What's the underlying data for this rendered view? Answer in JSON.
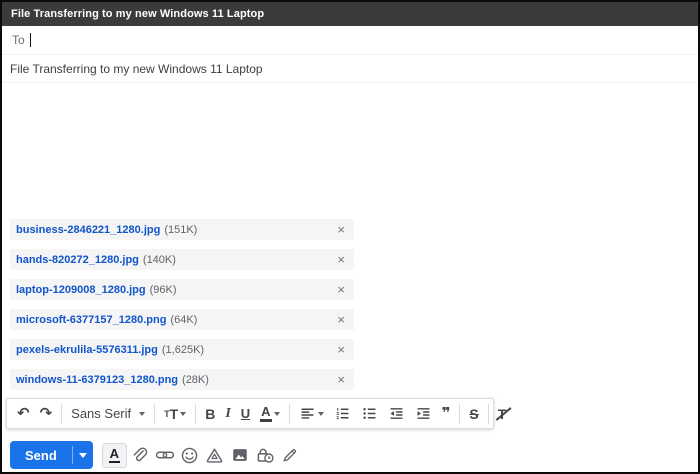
{
  "window": {
    "title": "File Transferring to my new Windows 11 Laptop"
  },
  "compose": {
    "to_label": "To",
    "subject": "File Transferring to my new Windows 11 Laptop",
    "attachments": [
      {
        "name": "business-2846221_1280.jpg",
        "size": "(151K)"
      },
      {
        "name": "hands-820272_1280.jpg",
        "size": "(140K)"
      },
      {
        "name": "laptop-1209008_1280.jpg",
        "size": "(96K)"
      },
      {
        "name": "microsoft-6377157_1280.png",
        "size": "(64K)"
      },
      {
        "name": "pexels-ekrulila-5576311.jpg",
        "size": "(1,625K)"
      },
      {
        "name": "windows-11-6379123_1280.png",
        "size": "(28K)"
      }
    ]
  },
  "format_toolbar": {
    "undo_glyph": "↶",
    "redo_glyph": "↷",
    "font_name": "Sans Serif",
    "size_glyph": "T",
    "bold_glyph": "B",
    "italic_glyph": "I",
    "underline_glyph": "U",
    "color_glyph": "A",
    "quote_glyph": "❞",
    "strike_glyph": "S",
    "clear_glyph": "T"
  },
  "send_bar": {
    "send_label": "Send",
    "format_toggle_glyph": "A"
  },
  "glyphs": {
    "close": "×"
  },
  "colors": {
    "titlebar_bg": "#3b3b3b",
    "send_blue": "#1a73e8",
    "attachment_link_blue": "#1155cc",
    "chip_bg": "#f5f5f5",
    "icon_gray": "#5f6368"
  }
}
